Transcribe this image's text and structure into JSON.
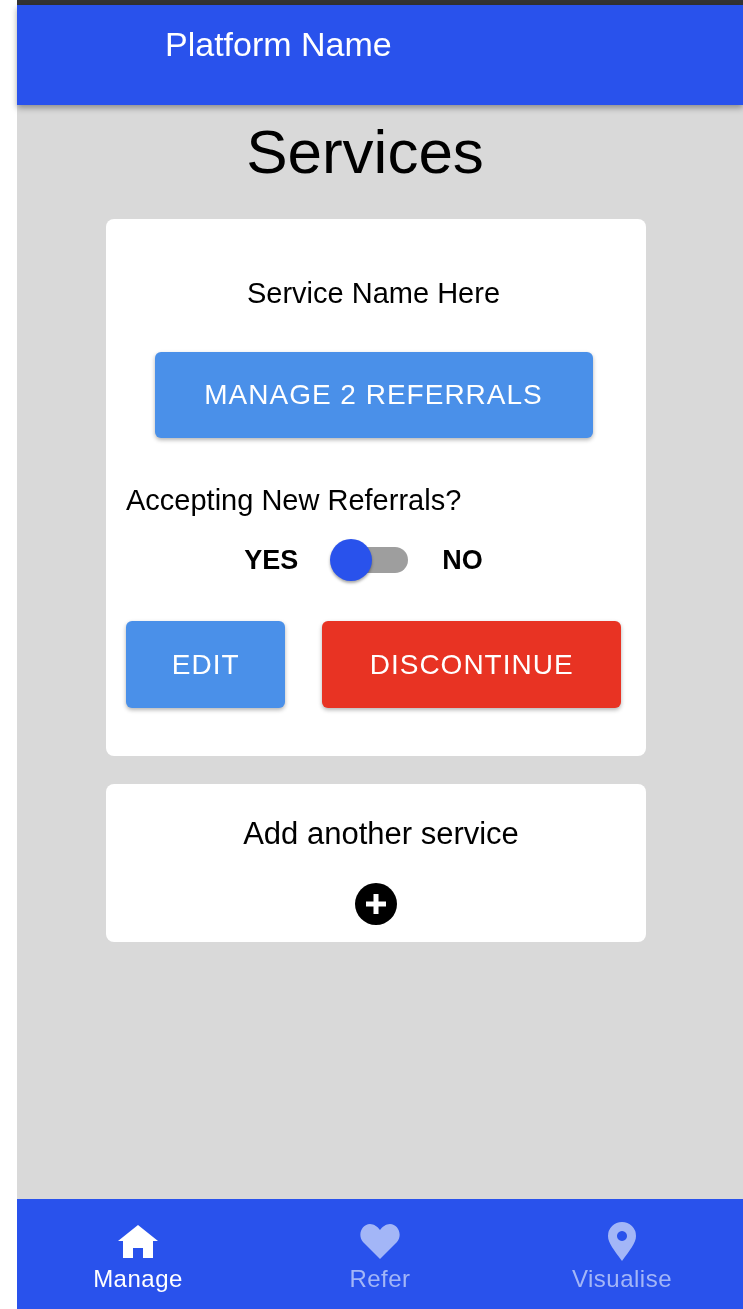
{
  "app_bar": {
    "title": "Platform Name"
  },
  "page_title": "Services",
  "services": [
    {
      "name": "Service Name Here",
      "manage_label": "MANAGE 2 REFERRALS",
      "accepting_label": "Accepting New Referrals?",
      "yes_label": "YES",
      "no_label": "NO",
      "on": true,
      "edit_label": "EDIT",
      "discontinue_label": "DISCONTINUE"
    }
  ],
  "add_card": {
    "label": "Add another service"
  },
  "nav": [
    {
      "label": "Manage",
      "kind": "home",
      "selected": true
    },
    {
      "label": "Refer",
      "kind": "heart",
      "selected": false
    },
    {
      "label": "Visualise",
      "kind": "pin",
      "selected": false
    }
  ]
}
